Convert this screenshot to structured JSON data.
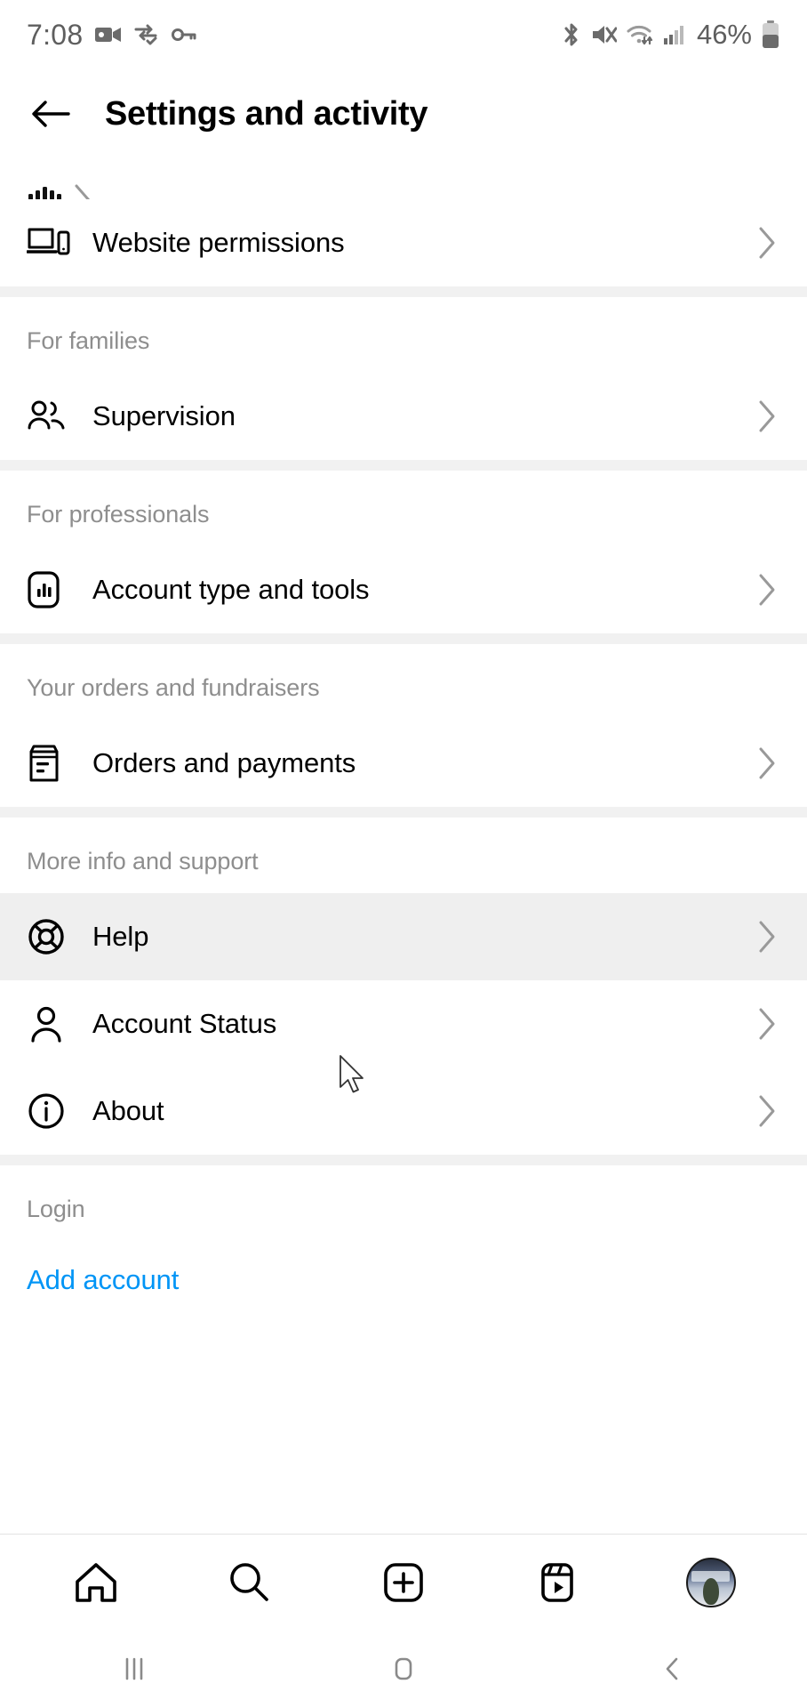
{
  "statusbar": {
    "time": "7:08",
    "battery_percent": "46%",
    "icons_left": [
      "video-camera-icon",
      "vpn-sync-icon",
      "vpn-key-icon"
    ],
    "icons_right": [
      "bluetooth-icon",
      "volume-mute-icon",
      "wifi-icon",
      "cellular-signal-icon",
      "battery-icon"
    ]
  },
  "header": {
    "title": "Settings and activity",
    "back_icon": "arrow-left-icon"
  },
  "list": {
    "clipped_top_row": {
      "label": "",
      "icon": "clipped-icon"
    },
    "groups": [
      {
        "section_title": null,
        "rows": [
          {
            "label": "Website permissions",
            "icon": "devices-icon",
            "chevron": "chevron-right-icon",
            "pressed": false
          }
        ]
      },
      {
        "section_title": "For families",
        "rows": [
          {
            "label": "Supervision",
            "icon": "people-icon",
            "chevron": "chevron-right-icon",
            "pressed": false
          }
        ]
      },
      {
        "section_title": "For professionals",
        "rows": [
          {
            "label": "Account type and tools",
            "icon": "insights-bar-chart-icon",
            "chevron": "chevron-right-icon",
            "pressed": false
          }
        ]
      },
      {
        "section_title": "Your orders and fundraisers",
        "rows": [
          {
            "label": "Orders and payments",
            "icon": "receipt-icon",
            "chevron": "chevron-right-icon",
            "pressed": false
          }
        ]
      },
      {
        "section_title": "More info and support",
        "rows": [
          {
            "label": "Help",
            "icon": "lifebuoy-icon",
            "chevron": "chevron-right-icon",
            "pressed": true
          },
          {
            "label": "Account Status",
            "icon": "person-icon",
            "chevron": "chevron-right-icon",
            "pressed": false
          },
          {
            "label": "About",
            "icon": "info-circle-icon",
            "chevron": "chevron-right-icon",
            "pressed": false
          }
        ]
      },
      {
        "section_title": "Login",
        "link": {
          "label": "Add account",
          "color": "#0095f6"
        }
      }
    ]
  },
  "bottomnav": {
    "items": [
      {
        "name": "home",
        "icon": "home-icon"
      },
      {
        "name": "search",
        "icon": "search-icon"
      },
      {
        "name": "create",
        "icon": "plus-square-icon"
      },
      {
        "name": "reels",
        "icon": "reels-icon"
      },
      {
        "name": "profile",
        "icon": "avatar-icon"
      }
    ]
  },
  "sysnav": {
    "items": [
      {
        "name": "recents",
        "icon": "recents-icon"
      },
      {
        "name": "home",
        "icon": "home-square-icon"
      },
      {
        "name": "back",
        "icon": "back-chevron-icon"
      }
    ]
  },
  "colors": {
    "accent_blue": "#0095f6",
    "section_label": "#8e8e8e",
    "divider": "#f1f1f1",
    "pressed_row": "#efefef",
    "text_primary": "#000000"
  }
}
